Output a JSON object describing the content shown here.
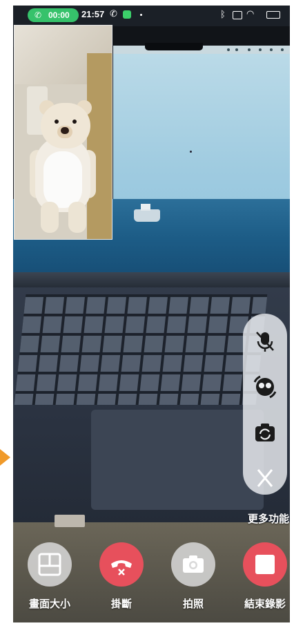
{
  "status_bar": {
    "call_timer": "00:00",
    "time": "21:57",
    "call_icon": "phone-icon",
    "message_icon": "message-icon",
    "right_icons": [
      "bluetooth-icon",
      "sim-icon",
      "wifi-icon",
      "battery-icon"
    ]
  },
  "side_controls": {
    "items": [
      {
        "name": "mute-microphone",
        "icon": "mic-off-icon"
      },
      {
        "name": "switch-effects",
        "icon": "face-swap-icon"
      },
      {
        "name": "flip-camera",
        "icon": "camera-flip-icon"
      },
      {
        "name": "close-panel",
        "icon": "close-icon"
      }
    ],
    "more_label": "更多功能"
  },
  "bottom_controls": [
    {
      "name": "screen-size",
      "label": "畫面大小",
      "icon": "layout-icon",
      "color": "#d9d9d9"
    },
    {
      "name": "hang-up",
      "label": "掛斷",
      "icon": "hangup-icon",
      "color": "#e7505c"
    },
    {
      "name": "take-photo",
      "label": "拍照",
      "icon": "camera-icon",
      "color": "#d9d9d9"
    },
    {
      "name": "end-recording",
      "label": "結束錄影",
      "icon": "stop-icon",
      "color": "#e7505c"
    }
  ],
  "colors": {
    "call_pill": "#36c26b",
    "red": "#e7505c",
    "accent_arrow": "#f09a2a"
  }
}
